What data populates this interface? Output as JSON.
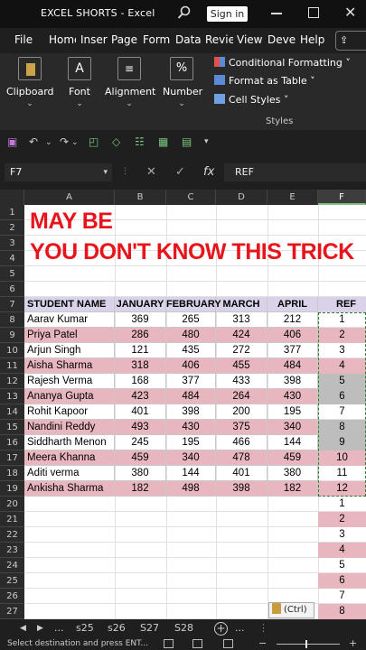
{
  "window": {
    "title": "EXCEL SHORTS  -  Excel",
    "signin": "Sign in"
  },
  "ribbon_tabs": [
    {
      "label": "File"
    },
    {
      "label": "Home"
    },
    {
      "label": "Insert"
    },
    {
      "label": "Page"
    },
    {
      "label": "Formulas"
    },
    {
      "label": "Data"
    },
    {
      "label": "Review"
    },
    {
      "label": "View"
    },
    {
      "label": "Developer"
    },
    {
      "label": "Help"
    }
  ],
  "share_label": "⇪",
  "ribbon": {
    "clipboard": "Clipboard",
    "font": "Font",
    "alignment": "Alignment",
    "number": "Number",
    "conditional_formatting": "Conditional Formatting ˅",
    "format_as_table": "Format as Table ˅",
    "cell_styles": "Cell Styles ˅",
    "styles_group": "Styles"
  },
  "formula_bar": {
    "name_box": "F7",
    "formula": "REF",
    "fx": "fx"
  },
  "columns": [
    "A",
    "B",
    "C",
    "D",
    "E",
    "F"
  ],
  "rows": [
    "1",
    "2",
    "3",
    "4",
    "5",
    "6",
    "7",
    "8",
    "9",
    "10",
    "11",
    "12",
    "13",
    "14",
    "15",
    "16",
    "17",
    "18",
    "19",
    "20",
    "21",
    "22",
    "23",
    "24",
    "25",
    "26",
    "27"
  ],
  "headline": {
    "line1": "MAY BE",
    "line2": "YOU DON'T KNOW THIS TRICK"
  },
  "table": {
    "headers": [
      "STUDENT NAME",
      "JANUARY",
      "FEBRUARY",
      "MARCH",
      "APRIL"
    ],
    "ref_header": "REF",
    "rows": [
      {
        "name": "Aarav Kumar",
        "jan": "369",
        "feb": "265",
        "mar": "313",
        "apr": "212"
      },
      {
        "name": "Priya Patel",
        "jan": "286",
        "feb": "480",
        "mar": "424",
        "apr": "406"
      },
      {
        "name": "Arjun Singh",
        "jan": "121",
        "feb": "435",
        "mar": "272",
        "apr": "377"
      },
      {
        "name": "Aisha Sharma",
        "jan": "318",
        "feb": "406",
        "mar": "455",
        "apr": "484"
      },
      {
        "name": "Rajesh Verma",
        "jan": "168",
        "feb": "377",
        "mar": "433",
        "apr": "398"
      },
      {
        "name": "Ananya Gupta",
        "jan": "423",
        "feb": "484",
        "mar": "264",
        "apr": "430"
      },
      {
        "name": "Rohit Kapoor",
        "jan": "401",
        "feb": "398",
        "mar": "200",
        "apr": "195"
      },
      {
        "name": "Nandini Reddy",
        "jan": "493",
        "feb": "430",
        "mar": "375",
        "apr": "340"
      },
      {
        "name": "Siddharth Menon",
        "jan": "245",
        "feb": "195",
        "mar": "466",
        "apr": "144"
      },
      {
        "name": "Meera Khanna",
        "jan": "459",
        "feb": "340",
        "mar": "478",
        "apr": "459"
      },
      {
        "name": "Aditi verma",
        "jan": "380",
        "feb": "144",
        "mar": "401",
        "apr": "380"
      },
      {
        "name": "Ankisha Sharma",
        "jan": "182",
        "feb": "498",
        "mar": "398",
        "apr": "182"
      }
    ],
    "ref_values": [
      "1",
      "2",
      "3",
      "4",
      "5",
      "6",
      "7",
      "8",
      "9",
      "10",
      "11",
      "12"
    ],
    "pasted_values": [
      "1",
      "2",
      "3",
      "4",
      "5",
      "6",
      "7",
      "8"
    ]
  },
  "paste_options": "(Ctrl) ▾",
  "sheet_tabs": [
    "...",
    "s25",
    "s26",
    "S27",
    "S28",
    "..."
  ],
  "status": {
    "message": "Select destination and press ENT..."
  },
  "colors": {
    "accent_red": "#e8141b",
    "row_pink": "#e8b6bf",
    "header_lavender": "#d9d2e9"
  }
}
